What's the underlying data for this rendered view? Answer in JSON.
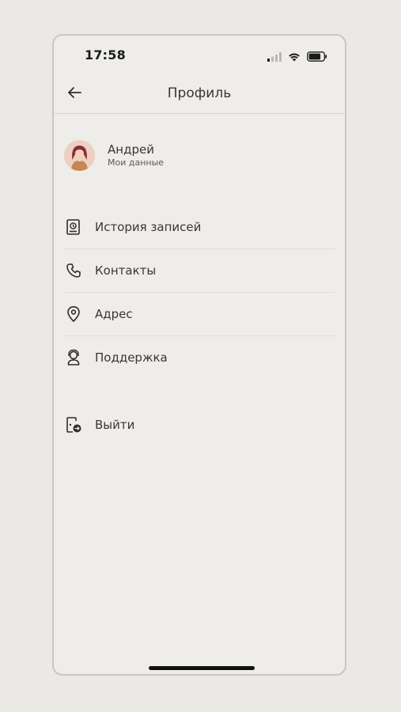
{
  "status_bar": {
    "time": "17:58",
    "icons": [
      "cellular-signal-icon",
      "wifi-icon",
      "battery-icon"
    ]
  },
  "header": {
    "title": "Профиль",
    "back_icon": "arrow-left-icon"
  },
  "profile": {
    "name": "Андрей",
    "subtitle": "Мои данные"
  },
  "menu": {
    "items": [
      {
        "label": "История записей",
        "icon": "calendar-clock-icon"
      },
      {
        "label": "Контакты",
        "icon": "phone-icon"
      },
      {
        "label": "Адрес",
        "icon": "map-pin-icon"
      },
      {
        "label": "Поддержка",
        "icon": "support-agent-icon"
      }
    ]
  },
  "logout": {
    "label": "Выйти",
    "icon": "logout-icon"
  },
  "colors": {
    "background": "#efedea",
    "text": "#3a3634",
    "divider": "#e0dedb",
    "avatar_bg": "#e9c9bb"
  }
}
